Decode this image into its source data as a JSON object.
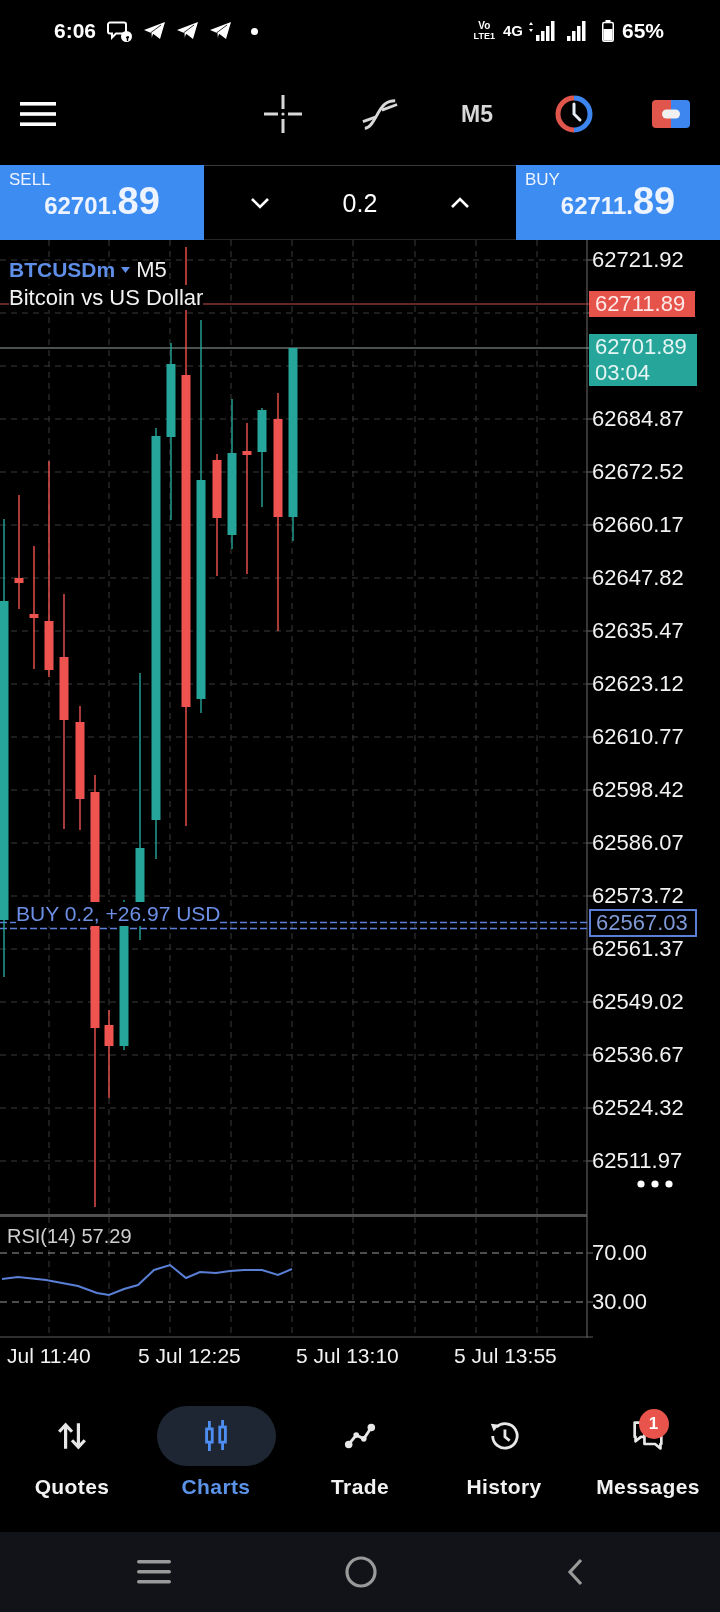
{
  "status_bar": {
    "time": "6:06",
    "volte_top": "Vo",
    "volte_bottom": "LTE1",
    "network": "4G",
    "battery": "65%"
  },
  "toolbar": {
    "timeframe": "M5"
  },
  "trade_bar": {
    "sell": {
      "label": "SELL",
      "price": "62701.",
      "pips": "89"
    },
    "volume": "0.2",
    "buy": {
      "label": "BUY",
      "price": "62711.",
      "pips": "89"
    }
  },
  "chart": {
    "symbol": "BTCUSDm",
    "timeframe": "M5",
    "description": "Bitcoin vs US Dollar",
    "price_ticks": [
      "62721.92",
      "62684.87",
      "62672.52",
      "62660.17",
      "62647.82",
      "62635.47",
      "62623.12",
      "62610.77",
      "62598.42",
      "62586.07",
      "62573.72",
      "62561.37",
      "62549.02",
      "62536.67",
      "62524.32",
      "62511.97"
    ],
    "ask_tag": "62711.89",
    "bid_tag": {
      "price": "62701.89",
      "countdown": "03:04"
    },
    "position": {
      "label": "BUY 0.2, +26.97 USD",
      "price": "62567.03"
    }
  },
  "rsi": {
    "label": "RSI(14) 57.29",
    "levels": [
      "70.00",
      "30.00"
    ]
  },
  "time_axis": [
    "Jul 11:40",
    "5 Jul 12:25",
    "5 Jul 13:10",
    "5 Jul 13:55"
  ],
  "nav": {
    "items": [
      {
        "label": "Quotes",
        "selected": false
      },
      {
        "label": "Charts",
        "selected": true
      },
      {
        "label": "Trade",
        "selected": false
      },
      {
        "label": "History",
        "selected": false
      },
      {
        "label": "Messages",
        "selected": false,
        "badge": "1"
      }
    ]
  }
}
